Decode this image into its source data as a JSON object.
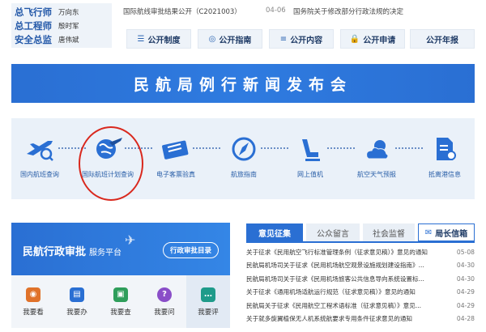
{
  "officials": [
    {
      "title": "总飞行师",
      "name": "万向东"
    },
    {
      "title": "总工程师",
      "name": "殷时军"
    },
    {
      "title": "安全总监",
      "name": "唐伟斌"
    }
  ],
  "top_news": [
    {
      "text": "国际航线审批结果公开（C2021003）",
      "date": "04-06"
    },
    {
      "text": "国务院关于修改部分行政法规的决定",
      "date": ""
    }
  ],
  "public_buttons": [
    {
      "icon": "☰",
      "label": "公开制度"
    },
    {
      "icon": "◎",
      "label": "公开指南"
    },
    {
      "icon": "≡",
      "label": "公开内容"
    },
    {
      "icon": "🔒",
      "label": "公开申请"
    },
    {
      "icon": "",
      "label": "公开年报"
    }
  ],
  "banner": {
    "title": "民航局例行新闻发布会"
  },
  "services": [
    {
      "label": "国内航班查询",
      "icon": "plane-search-icon"
    },
    {
      "label": "国际航班计划查询",
      "icon": "globe-plane-icon"
    },
    {
      "label": "电子客票验真",
      "icon": "ticket-icon"
    },
    {
      "label": "航旅指南",
      "icon": "compass-icon"
    },
    {
      "label": "网上值机",
      "icon": "seat-icon"
    },
    {
      "label": "航空天气预报",
      "icon": "weather-icon"
    },
    {
      "label": "抵离港信息",
      "icon": "document-icon"
    }
  ],
  "approval": {
    "title": "民航行政审批",
    "subtitle": "服务平台",
    "catalog_button": "行政审批目录",
    "items": [
      {
        "label": "我要看",
        "color": "#e0722a",
        "glyph": "◉"
      },
      {
        "label": "我要办",
        "color": "#2a6fd3",
        "glyph": "▤"
      },
      {
        "label": "我要查",
        "color": "#2f9e5b",
        "glyph": "▣"
      },
      {
        "label": "我要问",
        "color": "#8a4ec8",
        "glyph": "?"
      },
      {
        "label": "我要评",
        "color": "#1f9b8a",
        "glyph": "…"
      }
    ]
  },
  "tabs": {
    "consult": "意见征集",
    "messages": "公众留言",
    "supervision": "社会监督",
    "mailbox": "局长信箱"
  },
  "consult_list": [
    {
      "title": "关于征求《民用航空飞行标准管理条例（征求意见稿）》意见的通知",
      "date": "05-08"
    },
    {
      "title": "民航局机场司关于征求《民用机场航空观景设施规划建设指南》...",
      "date": "04-30"
    },
    {
      "title": "民航局机场司关于征求《民用机场旅客公共信息导向系统设置标...",
      "date": "04-30"
    },
    {
      "title": "关于征求《通用机场适航运行规范（征求意见稿）》意见的通知",
      "date": "04-29"
    },
    {
      "title": "民航局关于征求《民用航空工程术语标准（征求意见稿）》意见...",
      "date": "04-29"
    },
    {
      "title": "关于就多旋翼植保无人机系统航要求专用条件征求意见的通知",
      "date": "04-28"
    }
  ]
}
